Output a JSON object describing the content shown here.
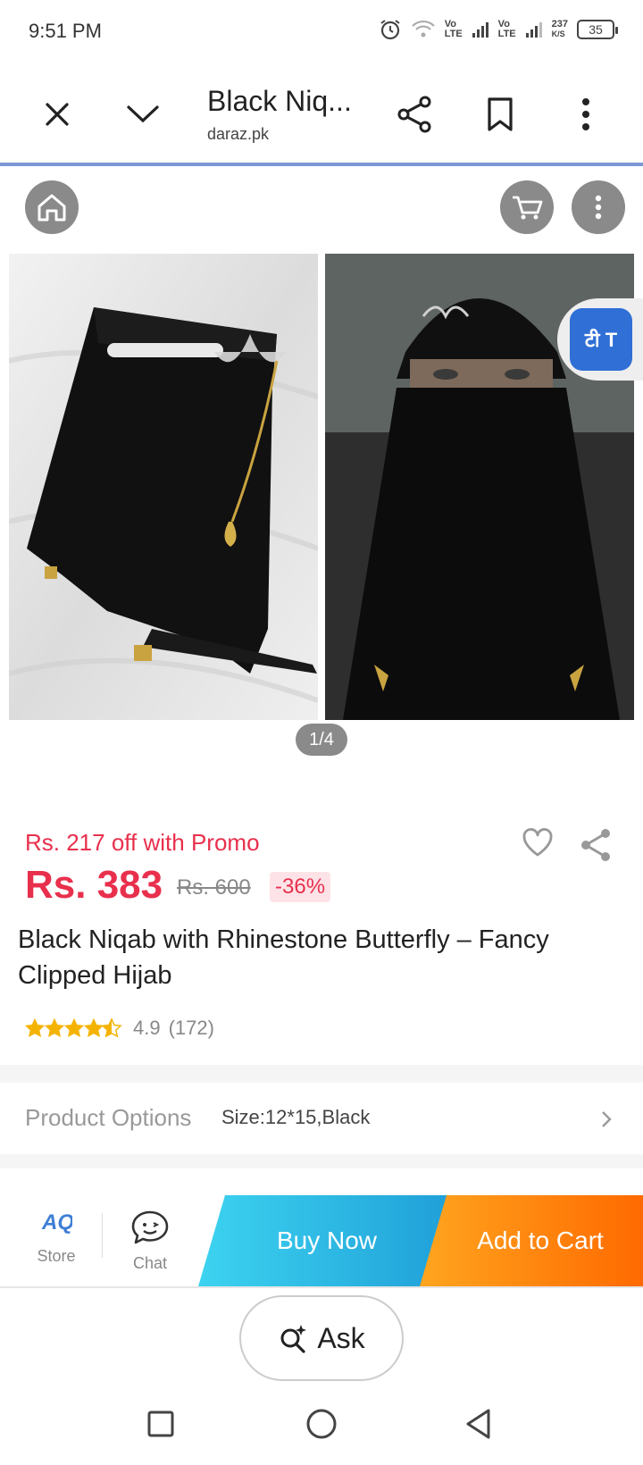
{
  "status_bar": {
    "time": "9:51 PM",
    "net1_top": "Vo",
    "net1_bottom": "LTE",
    "net2_top": "Vo",
    "net2_bottom": "LTE",
    "speed_top": "237",
    "speed_bottom": "K/S",
    "battery": "35"
  },
  "toolbar": {
    "title": "Black Niq...",
    "url": "daraz.pk",
    "icons": [
      "close-icon",
      "chevron-down-icon",
      "share-icon",
      "bookmark-icon",
      "more-vert-icon"
    ]
  },
  "page_controls": {
    "icons": [
      "home-icon",
      "cart-icon",
      "more-vert-icon"
    ]
  },
  "gallery": {
    "pager": "1/4",
    "translate_label": "टी T"
  },
  "product": {
    "promo": "Rs. 217 off with Promo",
    "price": "Rs. 383",
    "original_price": "Rs. 600",
    "discount": "-36%",
    "title": "Black Niqab with Rhinestone Butterfly – Fancy Clipped Hijab",
    "rating": "4.9",
    "reviews": "(172)",
    "stars": 4.5
  },
  "options": {
    "label": "Product Options",
    "value": "Size:12*15,Black"
  },
  "action_bar": {
    "store_label": "Store",
    "chat_label": "Chat",
    "buy_now": "Buy Now",
    "add_to_cart": "Add to Cart"
  },
  "ask": {
    "label": "Ask"
  },
  "colors": {
    "price_red": "#e8304d",
    "buy_blue": "#1f9fd8",
    "cart_orange": "#ff6a00",
    "toolbar_line": "#7b97d6"
  }
}
